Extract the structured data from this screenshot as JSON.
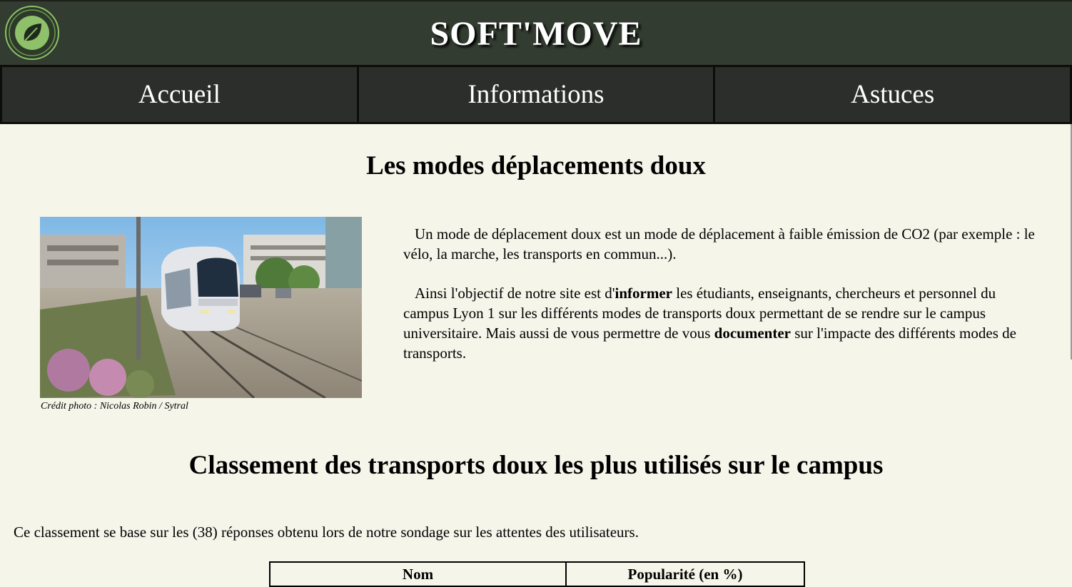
{
  "header": {
    "title": "SOFT'MOVE",
    "logo_icon": "leaf-icon",
    "colors": {
      "background": "#333c30",
      "logo_ring": "#8fc06a"
    }
  },
  "nav": {
    "items": [
      {
        "label": "Accueil"
      },
      {
        "label": "Informations"
      },
      {
        "label": "Astuces"
      }
    ]
  },
  "intro": {
    "heading": "Les modes déplacements doux",
    "photo_credit": "Crédit photo : Nicolas Robin / Sytral",
    "p1": "Un mode de déplacement doux est un mode de déplacement à faible émission de CO2 (par exemple : le vélo, la marche, les transports en commun...).",
    "p2_part1": "Ainsi l'objectif de notre site est d'",
    "p2_bold1": "informer",
    "p2_part2": " les étudiants, enseignants, chercheurs et personnel du campus Lyon 1 sur les différents modes de transports doux permettant de se rendre sur le campus universitaire. Mais aussi de vous permettre de vous ",
    "p2_bold2": "documenter",
    "p2_part3": " sur l'impacte des différents modes de transports."
  },
  "ranking": {
    "heading": "Classement des transports doux les plus utilisés sur le campus",
    "intro": "Ce classement se base sur les (38) réponses obtenu lors de notre sondage sur les attentes des utilisateurs.",
    "table_headers": [
      "Nom",
      "Popularité (en %)"
    ]
  }
}
